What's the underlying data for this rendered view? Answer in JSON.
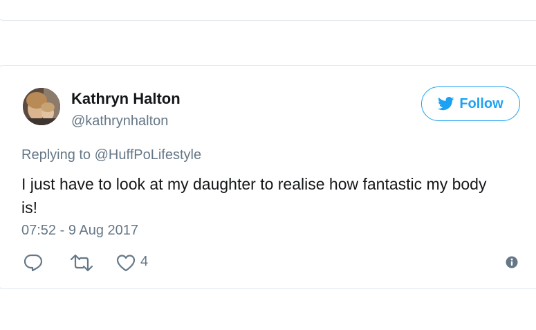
{
  "tweet": {
    "author": {
      "name": "Kathryn Halton",
      "handle": "@kathrynhalton"
    },
    "follow_label": "Follow",
    "reply_prefix": "Replying to",
    "reply_to": "@HuffPoLifestyle",
    "text": "I just have to look at my daughter to realise how fantastic my body is!",
    "timestamp": "07:52 - 9 Aug 2017",
    "like_count": "4"
  },
  "icons": {
    "reply": "reply-icon",
    "retweet": "retweet-icon",
    "like": "heart-icon",
    "info": "info-icon",
    "brand": "twitter-bird-icon"
  },
  "colors": {
    "accent": "#1da1f2",
    "secondary_text": "#657786",
    "primary_text": "#14171a",
    "border": "#e1e8ed"
  }
}
